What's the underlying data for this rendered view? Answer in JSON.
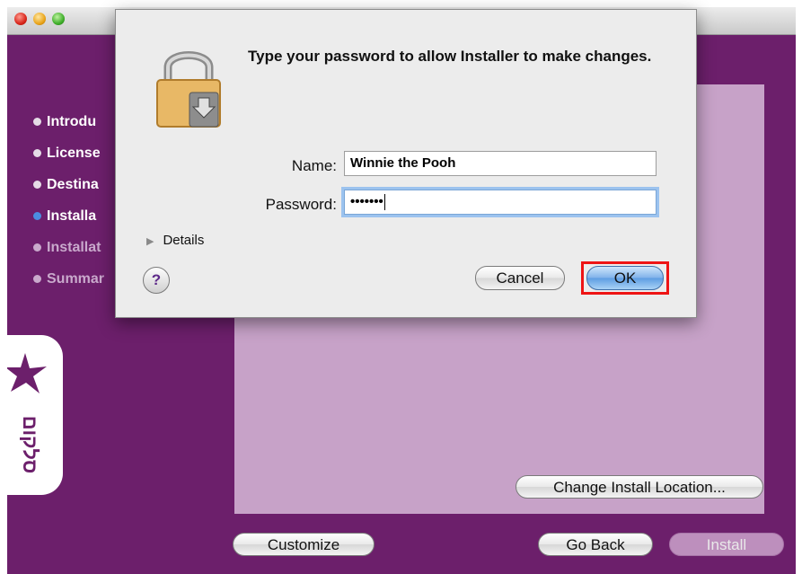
{
  "installer": {
    "steps": [
      {
        "label": "Introdu",
        "state": "done"
      },
      {
        "label": "License",
        "state": "done"
      },
      {
        "label": "Destina",
        "state": "done"
      },
      {
        "label": "Installa",
        "state": "active"
      },
      {
        "label": "Installat",
        "state": "pending"
      },
      {
        "label": "Summar",
        "state": "pending"
      }
    ],
    "brand_text": "סלקום",
    "change_location_label": "Change Install Location...",
    "customize_label": "Customize",
    "go_back_label": "Go Back",
    "install_label": "Install"
  },
  "dialog": {
    "title": "Type your password to allow Installer to make changes.",
    "name_label": "Name:",
    "name_value": "Winnie the Pooh",
    "password_label": "Password:",
    "password_value": "•••••••",
    "details_label": "Details",
    "help_label": "?",
    "cancel_label": "Cancel",
    "ok_label": "OK"
  },
  "colors": {
    "background_purple": "#6c1f6b",
    "panel_lilac": "#c7a2c8",
    "highlight_red": "#ee1414",
    "default_button_blue": "#5d9de2"
  }
}
